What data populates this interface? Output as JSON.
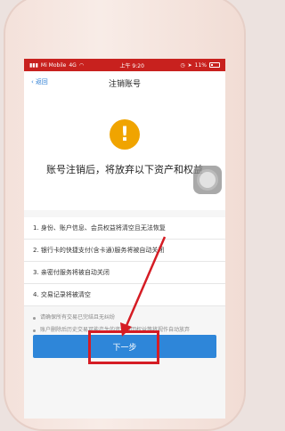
{
  "status_bar": {
    "carrier": "Mi Mobile",
    "network": "4G",
    "time": "上午 9:20",
    "battery": "11%"
  },
  "nav": {
    "back_label": "返回",
    "title": "注销账号"
  },
  "hero": {
    "icon_glyph": "!",
    "headline": "账号注销后，将放弃以下资产和权益"
  },
  "items": [
    "1. 身份、账户信息、会员权益将清空且无法恢复",
    "2. 银行卡的快捷支付(含卡通)服务将被自动关闭",
    "3. 亲密付服务将被自动关闭",
    "4. 交易记录将被清空"
  ],
  "notes": [
    "请确保所有交易已完结且无纠纷",
    "账户删除后历史交易可能产生的资金退回权益等将视作自动放弃"
  ],
  "actions": {
    "next_label": "下一步"
  },
  "colors": {
    "status_bar": "#c8211e",
    "accent": "#2e86d9",
    "warning": "#f0a400",
    "annotation": "#d51c24"
  }
}
